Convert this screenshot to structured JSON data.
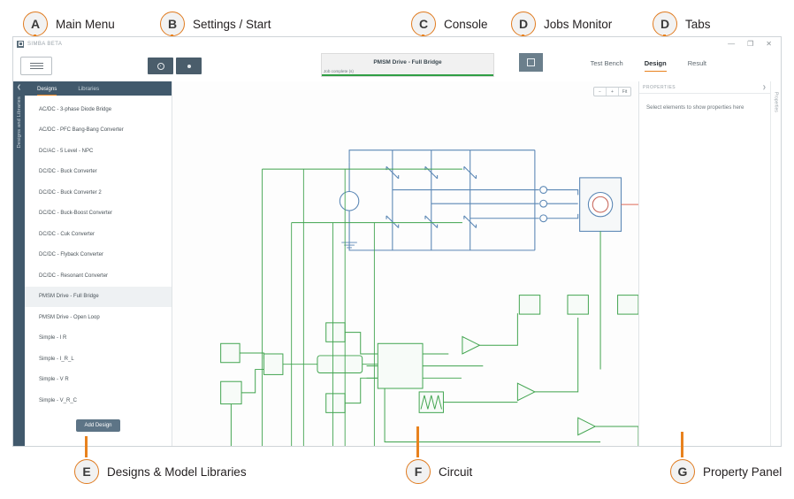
{
  "callouts": [
    {
      "id": "A",
      "label": "Main Menu"
    },
    {
      "id": "B",
      "label": "Settings / Start"
    },
    {
      "id": "C",
      "label": "Console"
    },
    {
      "id": "D",
      "label": "Jobs Monitor"
    },
    {
      "id": "D",
      "label": "Tabs"
    },
    {
      "id": "E",
      "label": "Designs & Model Libraries"
    },
    {
      "id": "F",
      "label": "Circuit"
    },
    {
      "id": "G",
      "label": "Property Panel"
    }
  ],
  "window": {
    "title": "SIMBA BETA",
    "controls": {
      "minimize": "—",
      "maximize": "❐",
      "close": "✕"
    }
  },
  "toolbar": {
    "menu_icon": "hamburger-icon",
    "settings_icon": "gear-icon",
    "run_icon": "play-icon"
  },
  "console": {
    "title": "PMSM Drive - Full Bridge",
    "status": "Job complete (s)",
    "progress_color": "#2f9e44",
    "jobs_icon": "jobs-monitor-icon"
  },
  "tabs": {
    "items": [
      {
        "label": "Test Bench",
        "active": false
      },
      {
        "label": "Design",
        "active": true
      },
      {
        "label": "Result",
        "active": false
      }
    ]
  },
  "left_rail": {
    "collapse_icon": "chevron-left-icon",
    "label": "Designs and Libraries"
  },
  "sidebar": {
    "tabs": [
      {
        "label": "Designs",
        "active": true
      },
      {
        "label": "Libraries",
        "active": false
      }
    ],
    "items": [
      {
        "label": "AC/DC - 3-phase Diode Bridge",
        "selected": false
      },
      {
        "label": "AC/DC - PFC Bang-Bang Converter",
        "selected": false
      },
      {
        "label": "DC/AC - 5 Level - NPC",
        "selected": false
      },
      {
        "label": "DC/DC - Buck Converter",
        "selected": false
      },
      {
        "label": "DC/DC - Buck Converter 2",
        "selected": false
      },
      {
        "label": "DC/DC - Buck-Boost Converter",
        "selected": false
      },
      {
        "label": "DC/DC - Cuk Converter",
        "selected": false
      },
      {
        "label": "DC/DC - Flyback Converter",
        "selected": false
      },
      {
        "label": "DC/DC - Resonant Converter",
        "selected": false
      },
      {
        "label": "PMSM Drive - Full Bridge",
        "selected": true
      },
      {
        "label": "PMSM Drive - Open Loop",
        "selected": false
      },
      {
        "label": "Simple - I R",
        "selected": false
      },
      {
        "label": "Simple - I_R_L",
        "selected": false
      },
      {
        "label": "Simple - V R",
        "selected": false
      },
      {
        "label": "Simple - V_R_C",
        "selected": false
      }
    ],
    "add_button": "Add Design"
  },
  "canvas": {
    "zoom_controls": [
      {
        "label": "−",
        "name": "zoom-out-button"
      },
      {
        "label": "+",
        "name": "zoom-in-button"
      },
      {
        "label": "Fit",
        "name": "zoom-fit-button"
      }
    ],
    "schematic_colors": {
      "power": "#5b87b5",
      "control": "#3fa34d",
      "thermal": "#e06c5a",
      "block_fill": "#f6f8f9"
    }
  },
  "properties": {
    "header": "PROPERTIES",
    "expand_icon": "chevron-right-icon",
    "empty_message": "Select elements to show properties here",
    "rail_label": "Properties"
  }
}
